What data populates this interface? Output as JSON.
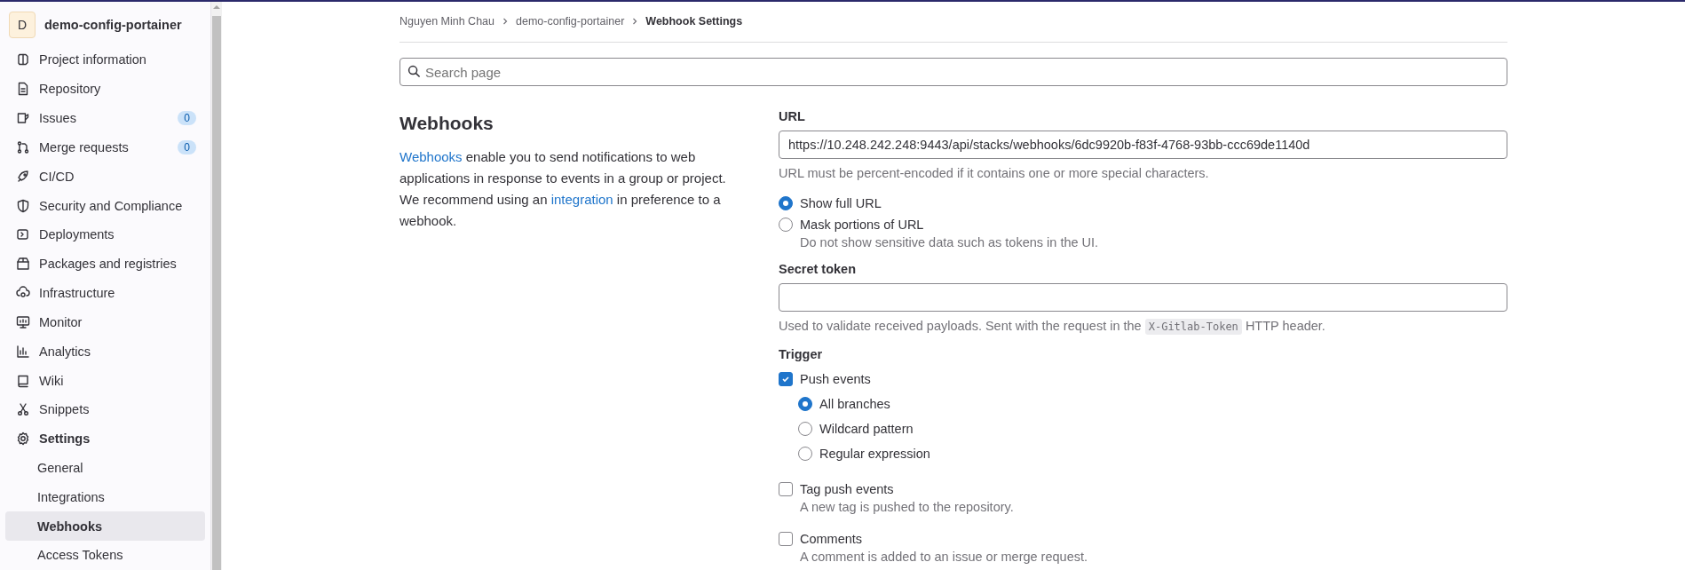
{
  "sidebar": {
    "project": {
      "avatar": "D",
      "name": "demo-config-portainer"
    },
    "items": [
      {
        "label": "Project information",
        "active": false
      },
      {
        "label": "Repository",
        "active": false
      },
      {
        "label": "Issues",
        "active": false,
        "count": "0"
      },
      {
        "label": "Merge requests",
        "active": false,
        "count": "0"
      },
      {
        "label": "CI/CD",
        "active": false
      },
      {
        "label": "Security and Compliance",
        "active": false
      },
      {
        "label": "Deployments",
        "active": false
      },
      {
        "label": "Packages and registries",
        "active": false
      },
      {
        "label": "Infrastructure",
        "active": false
      },
      {
        "label": "Monitor",
        "active": false
      },
      {
        "label": "Analytics",
        "active": false
      },
      {
        "label": "Wiki",
        "active": false
      },
      {
        "label": "Snippets",
        "active": false
      },
      {
        "label": "Settings",
        "active": true,
        "expanded": true,
        "children": [
          {
            "label": "General",
            "selected": false
          },
          {
            "label": "Integrations",
            "selected": false
          },
          {
            "label": "Webhooks",
            "selected": true
          },
          {
            "label": "Access Tokens",
            "selected": false
          }
        ]
      }
    ]
  },
  "breadcrumb": [
    {
      "label": "Nguyen Minh Chau",
      "current": false
    },
    {
      "label": "demo-config-portainer",
      "current": false
    },
    {
      "label": "Webhook Settings",
      "current": true
    }
  ],
  "search": {
    "placeholder": "Search page"
  },
  "section": {
    "title": "Webhooks",
    "description": [
      {
        "text": "Webhooks",
        "link": true
      },
      {
        "text": " enable you to send notifications to web applications in response to events in a group or project. We recommend using an ",
        "link": false
      },
      {
        "text": "integration",
        "link": true
      },
      {
        "text": " in preference to a webhook.",
        "link": false
      }
    ]
  },
  "form": {
    "url": {
      "label": "URL",
      "value": "https://10.248.242.248:9443/api/stacks/webhooks/6dc9920b-f83f-4768-93bb-ccc69de1140d",
      "hint": "URL must be percent-encoded if it contains one or more special characters."
    },
    "url_display": [
      {
        "label": "Show full URL",
        "selected": true
      },
      {
        "label": "Mask portions of URL",
        "selected": false,
        "hint": "Do not show sensitive data such as tokens in the UI."
      }
    ],
    "secret_token": {
      "label": "Secret token",
      "hint": [
        {
          "text": "Used to validate received payloads. Sent with the request in the ",
          "code": false
        },
        {
          "text": "X-Gitlab-Token",
          "code": true
        },
        {
          "text": " HTTP header.",
          "code": false
        }
      ]
    },
    "trigger": {
      "label": "Trigger",
      "events": [
        {
          "label": "Push events",
          "checked": true,
          "options": [
            {
              "label": "All branches",
              "selected": true
            },
            {
              "label": "Wildcard pattern",
              "selected": false
            },
            {
              "label": "Regular expression",
              "selected": false
            }
          ]
        },
        {
          "label": "Tag push events",
          "checked": false,
          "hint": "A new tag is pushed to the repository."
        },
        {
          "label": "Comments",
          "checked": false,
          "hint": "A comment is added to an issue or merge request."
        }
      ]
    }
  }
}
